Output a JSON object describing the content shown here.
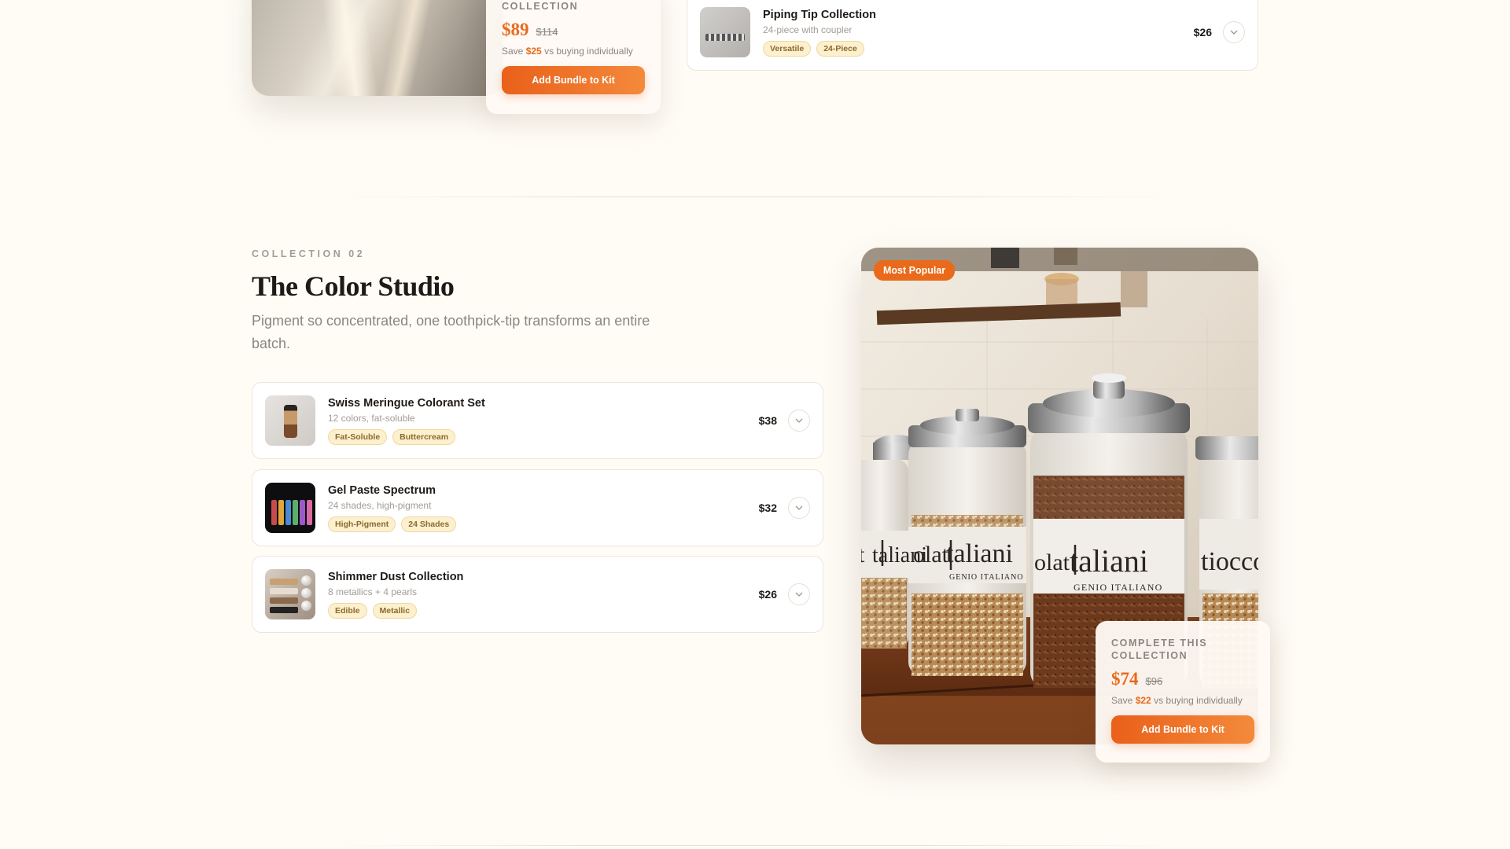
{
  "top_collection": {
    "bundle": {
      "kicker": "COLLECTION",
      "price": "$89",
      "old_price": "$114",
      "save_prefix": "Save",
      "save_amount": "$25",
      "save_suffix": "vs buying individually",
      "button_label": "Add Bundle to Kit"
    },
    "product": {
      "name": "Piping Tip Collection",
      "subtitle": "24-piece with coupler",
      "tags": [
        "Versatile",
        "24-Piece"
      ],
      "price": "$26"
    }
  },
  "collection": {
    "kicker": "COLLECTION 02",
    "title": "The Color Studio",
    "description": "Pigment so concentrated, one toothpick-tip transforms an entire batch.",
    "hero_badge": "Most Popular",
    "hero_jar_labels": [
      "taliani",
      "GENIO ITALIANO"
    ],
    "products": [
      {
        "name": "Swiss Meringue Colorant Set",
        "subtitle": "12 colors, fat-soluble",
        "tags": [
          "Fat-Soluble",
          "Buttercream"
        ],
        "price": "$38"
      },
      {
        "name": "Gel Paste Spectrum",
        "subtitle": "24 shades, high-pigment",
        "tags": [
          "High-Pigment",
          "24 Shades"
        ],
        "price": "$32"
      },
      {
        "name": "Shimmer Dust Collection",
        "subtitle": "8 metallics + 4 pearls",
        "tags": [
          "Edible",
          "Metallic"
        ],
        "price": "$26"
      }
    ],
    "bundle": {
      "kicker": "COMPLETE THIS COLLECTION",
      "price": "$74",
      "old_price": "$96",
      "save_prefix": "Save",
      "save_amount": "$22",
      "save_suffix": "vs buying individually",
      "button_label": "Add Bundle to Kit"
    }
  },
  "icons": {
    "expand": "chevron-down-icon"
  },
  "colors": {
    "accent": "#e96a1b",
    "background": "#fffcf6",
    "tag_bg": "#fdf0cf"
  }
}
